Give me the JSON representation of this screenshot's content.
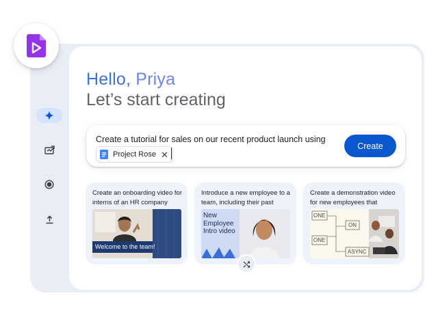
{
  "greeting": {
    "hello": "Hello,",
    "name": "Priya"
  },
  "subheading": "Let’s start creating",
  "sidebar": {
    "items": [
      {
        "icon": "sparkle-icon",
        "active": true
      },
      {
        "icon": "template-icon",
        "active": false
      },
      {
        "icon": "record-icon",
        "active": false
      },
      {
        "icon": "upload-icon",
        "active": false
      }
    ]
  },
  "prompt": {
    "text": "Create a tutorial for sales on our recent product launch using",
    "chip_label": "Project Rose",
    "chip_icon": "docs-icon",
    "create_label": "Create"
  },
  "suggestions": [
    {
      "text": "Create an onboarding video for interns of an HR company",
      "thumb_caption": "Welcome to the team!"
    },
    {
      "text": "Introduce a new employee to a team, including their past roles...",
      "thumb_title": "New Employee Intro video"
    },
    {
      "text": "Create a demonstration video for new employees that details...",
      "diagram_labels": [
        "ONE",
        "ON",
        "ONE",
        "ASYNC"
      ]
    }
  ],
  "colors": {
    "accent": "#0b57d0",
    "hello": "#3b74d8",
    "name": "#6b86e6",
    "app_icon": "#9334e6",
    "panel": "#e8edf6",
    "card": "#eef2fa"
  }
}
